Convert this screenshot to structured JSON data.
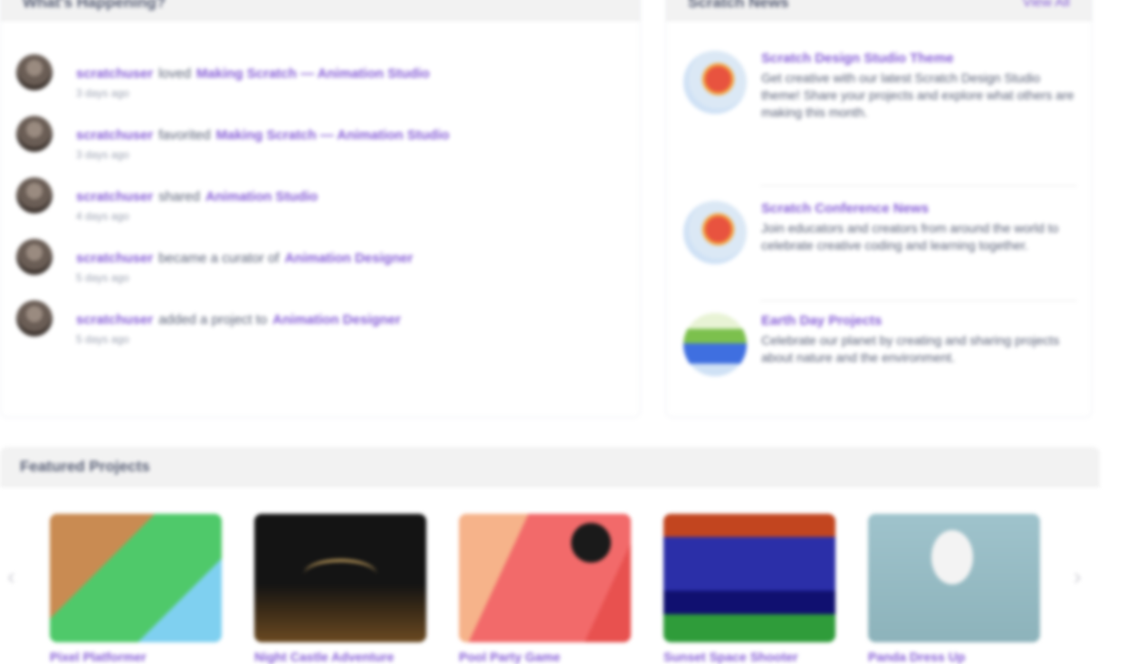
{
  "activity": {
    "heading": "What's Happening?",
    "items": [
      {
        "user": "scratchuser",
        "verb": "loved",
        "target": "Making Scratch — Animation Studio",
        "time": "3 days ago"
      },
      {
        "user": "scratchuser",
        "verb": "favorited",
        "target": "Making Scratch — Animation Studio",
        "time": "3 days ago"
      },
      {
        "user": "scratchuser",
        "verb": "shared",
        "target": "Animation Studio",
        "time": "4 days ago"
      },
      {
        "user": "scratchuser",
        "verb": "became a curator of",
        "target": "Animation Designer",
        "time": "5 days ago"
      },
      {
        "user": "scratchuser",
        "verb": "added a project to",
        "target": "Animation Designer",
        "time": "5 days ago"
      }
    ]
  },
  "news": {
    "heading": "Scratch News",
    "view_all": "View All",
    "items": [
      {
        "icon": "scratch-flag-icon",
        "title": "Scratch Design Studio Theme",
        "body": "Get creative with our latest Scratch Design Studio theme! Share your projects and explore what others are making this month."
      },
      {
        "icon": "scratch-flag-icon",
        "title": "Scratch Conference News",
        "body": "Join educators and creators from around the world to celebrate creative coding and learning together."
      },
      {
        "icon": "earth-icon",
        "title": "Earth Day Projects",
        "body": "Celebrate our planet by creating and sharing projects about nature and the environment."
      }
    ]
  },
  "featured": {
    "heading": "Featured Projects",
    "prev": "‹",
    "next": "›",
    "projects": [
      {
        "title": "Pixel Platformer"
      },
      {
        "title": "Night Castle Adventure"
      },
      {
        "title": "Pool Party Game"
      },
      {
        "title": "Sunset Space Shooter"
      },
      {
        "title": "Panda Dress Up"
      }
    ]
  }
}
